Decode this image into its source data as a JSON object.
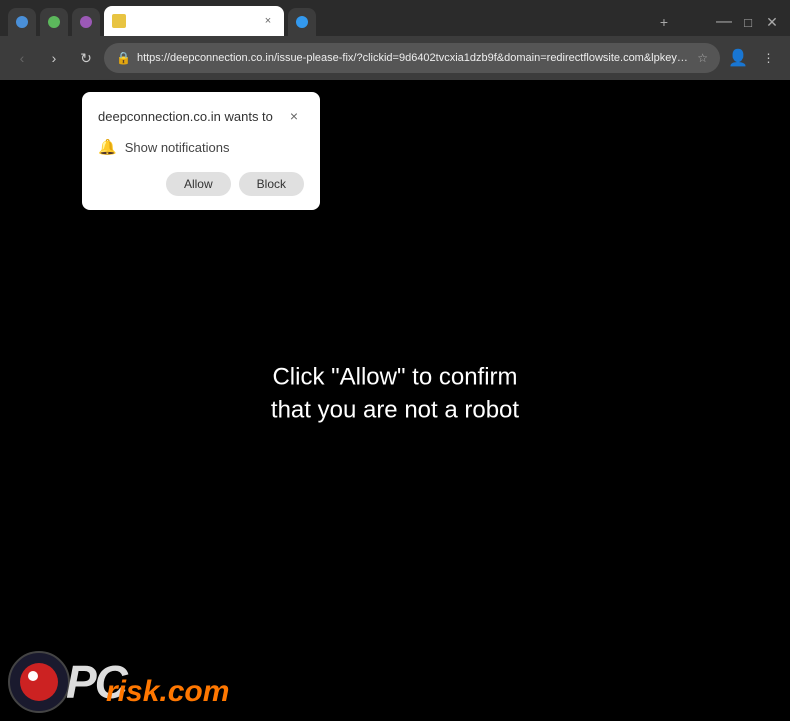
{
  "browser": {
    "tabs": [
      {
        "id": "tab-1",
        "label": "",
        "active": false,
        "favicon": "circle-blue"
      },
      {
        "id": "tab-2",
        "label": "",
        "active": false,
        "favicon": "circle-green"
      },
      {
        "id": "tab-3",
        "label": "",
        "active": false,
        "favicon": "circle-purple"
      },
      {
        "id": "tab-4",
        "label": "",
        "active": true,
        "favicon": "warning",
        "close": "×"
      },
      {
        "id": "tab-5",
        "label": "",
        "active": false,
        "favicon": "circle-blue2"
      }
    ],
    "address_bar": {
      "url": "https://deepconnection.co.in/issue-please-fix/?clickid=9d6402tvcxia1dzb9f&domain=redirectflowsite.com&lpkey=1...",
      "secure_icon": "🔒"
    },
    "nav": {
      "back": "‹",
      "forward": "›",
      "refresh": "↻",
      "home": "⌂"
    }
  },
  "notification_popup": {
    "title": "deepconnection.co.in wants to",
    "close_label": "×",
    "notification_row": {
      "icon": "🔔",
      "text": "Show notifications"
    },
    "buttons": {
      "allow": "Allow",
      "block": "Block"
    }
  },
  "page": {
    "background_color": "#000000",
    "main_text_line1": "Click \"Allow\" to confirm",
    "main_text_line2": "that you are not a robot"
  },
  "logo": {
    "pc_text": "PC",
    "risk_text": "risk.com"
  }
}
